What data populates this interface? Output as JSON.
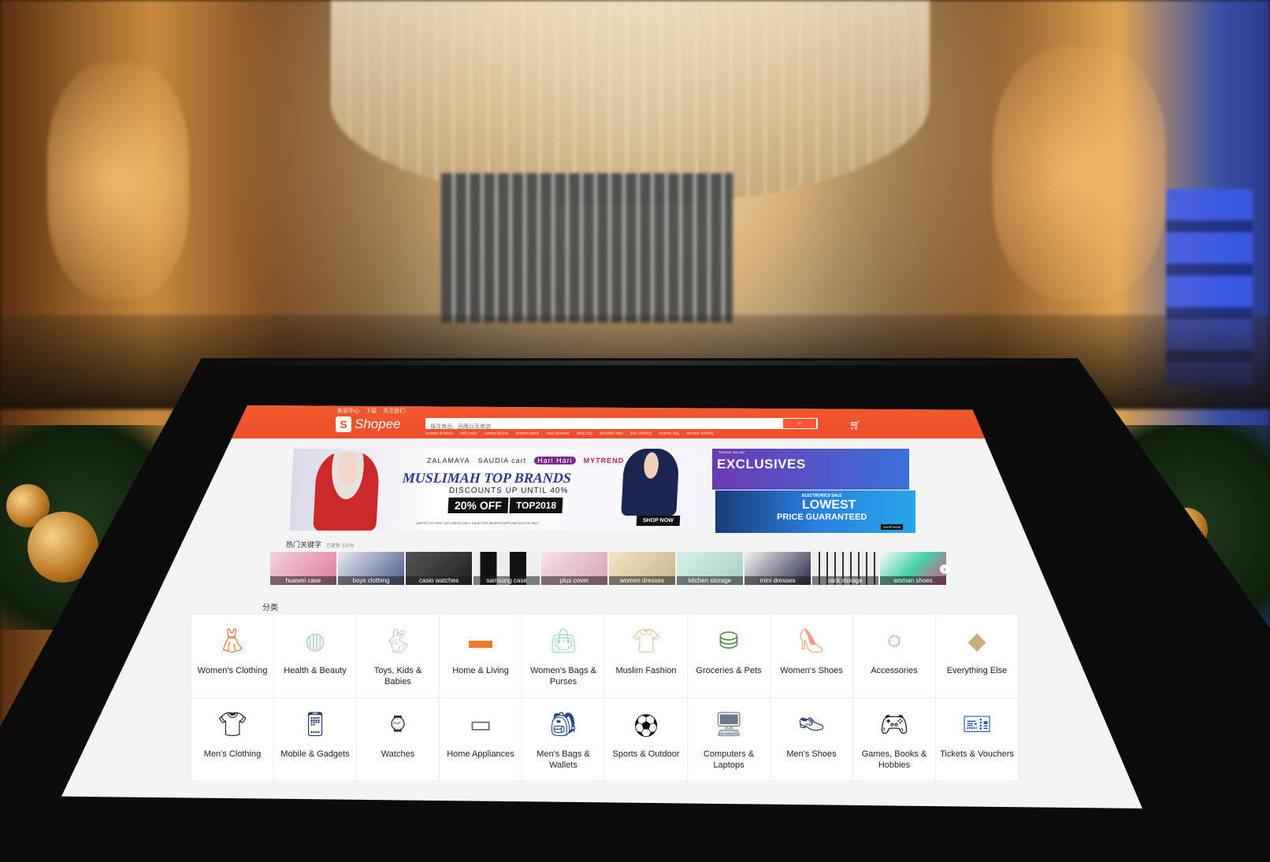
{
  "header": {
    "top_links": [
      "卖家中心",
      "下载",
      "关注我们"
    ],
    "logo_text": "Shopee",
    "search_placeholder": "搜寻商品、品牌以及商店",
    "hot_searches": [
      "women dresses",
      "soft cover",
      "casing iphone",
      "women pants",
      "maxi dresses",
      "sling bag",
      "shoulder tops",
      "kids clothing",
      "women bag",
      "women clothing"
    ]
  },
  "banner_main": {
    "brands": [
      "ZALAMAYA",
      "SAUDIA cart",
      "Hari Hari",
      "MYTREND"
    ],
    "title": "MUSLIMAH TOP BRANDS",
    "subtitle": "DISCOUNTS UP UNTIL 40%",
    "discount": "20% OFF",
    "promo_code": "TOP2018",
    "fine_print": "LIMITED TO FIRST 300 USERS ONLY. VALID FOR SHOPEE APP CHECKOUTS ONLY",
    "cta": "SHOP NOW"
  },
  "banner_side": {
    "kicker": "SHOPEE SELLER",
    "headline": "EXCLUSIVES",
    "sale_label": "ELECTRONICS SALE",
    "lowest": "LOWEST",
    "price_guaranteed": "PRICE GUARANTEED",
    "cta": "SHOP NOW"
  },
  "trending": {
    "title": "热门关键字",
    "updated": "已更新 12PM",
    "items": [
      "huawei case",
      "boys clothing",
      "casio watches",
      "samsung case",
      "plus cover",
      "women dresses",
      "kitchen storage",
      "mini dresses",
      "rack storage",
      "woman shoes"
    ]
  },
  "categories": {
    "title": "分类",
    "items": [
      {
        "name": "Women's Clothing",
        "icon": "dress-icon"
      },
      {
        "name": "Health & Beauty",
        "icon": "compact-icon"
      },
      {
        "name": "Toys, Kids & Babies",
        "icon": "plush-bunny-icon"
      },
      {
        "name": "Home & Living",
        "icon": "storage-box-icon"
      },
      {
        "name": "Women's Bags & Purses",
        "icon": "handbag-icon"
      },
      {
        "name": "Muslim Fashion",
        "icon": "blouse-icon"
      },
      {
        "name": "Groceries & Pets",
        "icon": "jar-icon"
      },
      {
        "name": "Women's Shoes",
        "icon": "heels-icon"
      },
      {
        "name": "Accessories",
        "icon": "bracelet-icon"
      },
      {
        "name": "Everything Else",
        "icon": "pillow-icon"
      },
      {
        "name": "Men's Clothing",
        "icon": "shirt-icon"
      },
      {
        "name": "Mobile & Gadgets",
        "icon": "phone-icon"
      },
      {
        "name": "Watches",
        "icon": "watch-icon"
      },
      {
        "name": "Home Appliances",
        "icon": "oven-icon"
      },
      {
        "name": "Men's Bags & Wallets",
        "icon": "backpack-icon"
      },
      {
        "name": "Sports & Outdoor",
        "icon": "football-icon"
      },
      {
        "name": "Computers & Laptops",
        "icon": "monitor-icon"
      },
      {
        "name": "Men's Shoes",
        "icon": "shoe-icon"
      },
      {
        "name": "Games, Books & Hobbies",
        "icon": "gamepad-icon"
      },
      {
        "name": "Tickets & Vouchers",
        "icon": "ticket-icon"
      }
    ]
  },
  "colors": {
    "brand": "#ee4d2d",
    "banner_blue": "#2a3b8f",
    "exclusive_purple": "#6c39b5"
  }
}
